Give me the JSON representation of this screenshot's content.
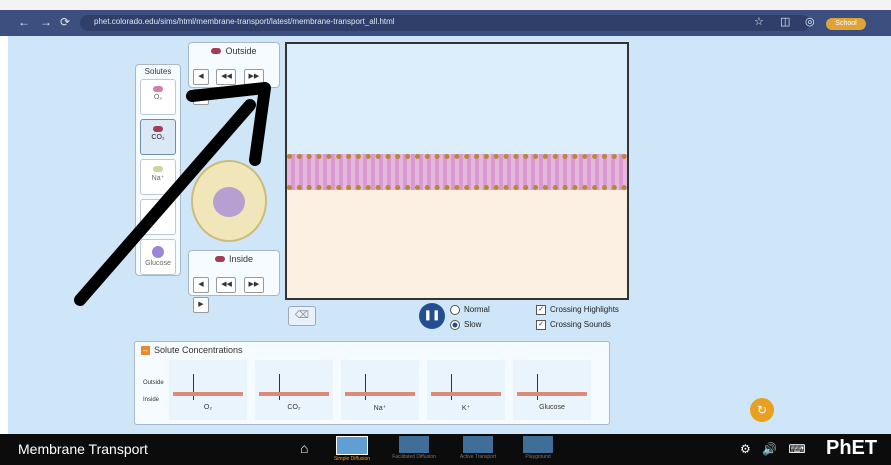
{
  "browser": {
    "url": "phet.colorado.edu/sims/html/membrane-transport/latest/membrane-transport_all.html",
    "profile_label": "School"
  },
  "solutes": {
    "title": "Solutes",
    "items": [
      {
        "label": "O₂",
        "active": false
      },
      {
        "label": "CO₂",
        "active": true
      },
      {
        "label": "Na⁺",
        "active": false
      },
      {
        "label": "",
        "active": false
      },
      {
        "label": "Glucose",
        "active": false
      }
    ]
  },
  "outside_panel": {
    "title": "Outside"
  },
  "inside_panel": {
    "title": "Inside"
  },
  "playback": {
    "normal_label": "Normal",
    "slow_label": "Slow",
    "selected": "Slow",
    "crossing_highlights_label": "Crossing Highlights",
    "crossing_sounds_label": "Crossing Sounds"
  },
  "concentrations": {
    "title": "Solute Concentrations",
    "outside_label": "Outside",
    "inside_label": "Inside",
    "items": [
      "O₂",
      "CO₂",
      "Na⁺",
      "K⁺",
      "Glucose"
    ]
  },
  "bottom_bar": {
    "title": "Membrane Transport",
    "screens": [
      "Simple Diffusion",
      "Facilitated Diffusion",
      "Active Transport",
      "Playground"
    ],
    "active_screen": "Simple Diffusion",
    "brand": "PhET"
  }
}
